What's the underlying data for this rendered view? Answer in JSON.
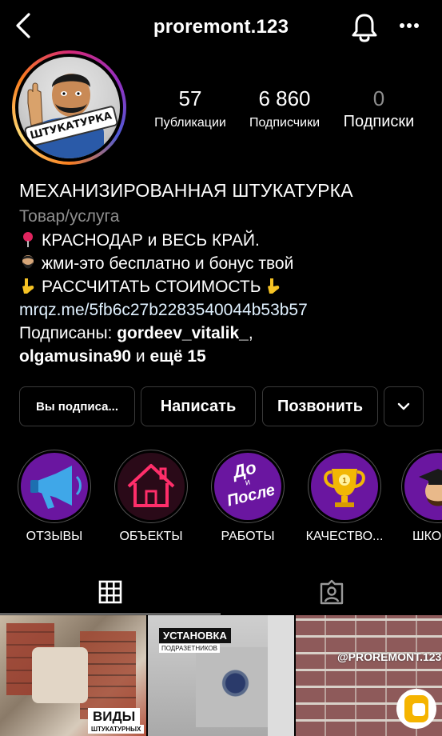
{
  "header": {
    "username": "proremont.123",
    "back_icon": "chevron-left-icon",
    "bell_icon": "bell-icon",
    "more_icon": "more-horizontal-icon"
  },
  "avatar": {
    "badge_text": "ШТУКАТУРКА"
  },
  "stats": {
    "posts": {
      "value": "57",
      "label": "Публикации"
    },
    "followers": {
      "value": "6 860",
      "label": "Подписчики"
    },
    "following": {
      "value": "0",
      "label": "Подписки"
    }
  },
  "bio": {
    "name": "МЕХАНИЗИРОВАННАЯ ШТУКАТУРКА",
    "category": "Товар/услуга",
    "line1": "КРАСНОДАР и ВЕСЬ КРАЙ.",
    "line2": "жми-это бесплатно и бонус твой",
    "line3": "РАССЧИТАТЬ СТОИМОСТЬ",
    "link": "mrqz.me/5fb6c27b2283540044b53b57",
    "followed_prefix": "Подписаны: ",
    "followed_user1": "gordeev_vitalik_",
    "followed_sep": ",",
    "followed_user2": "olgamusina90",
    "followed_and": " и ",
    "followed_more": "ещё 15"
  },
  "actions": {
    "following_label": "Вы подписа...",
    "message_label": "Написать",
    "call_label": "Позвонить",
    "expand_icon": "chevron-down-icon"
  },
  "highlights": [
    {
      "label": "ОТЗЫВЫ",
      "icon": "megaphone-icon"
    },
    {
      "label": "ОБЪЕКТЫ",
      "icon": "house-icon"
    },
    {
      "label": "РАБОТЫ",
      "icon": "before-after-icon",
      "text_top": "До",
      "text_mid": "и",
      "text_bottom": "После"
    },
    {
      "label": "КАЧЕСТВО...",
      "icon": "trophy-icon"
    },
    {
      "label": "ШКО",
      "icon": "graduate-icon"
    }
  ],
  "tabs": {
    "grid_icon": "grid-icon",
    "tagged_icon": "tagged-person-icon"
  },
  "posts": [
    {
      "caption": "ВИДЫ",
      "subcaption": "ШТУКАТУРНЫХ"
    },
    {
      "caption": "УСТАНОВКА",
      "subcaption": "ПОДРАЗЕТНИКОВ"
    },
    {
      "caption": "@PROREMONT.123"
    }
  ],
  "colors": {
    "background": "#000000",
    "highlight_purple": "#6a16a0",
    "link": "#e0f1ff",
    "muted": "#8e8e8e"
  }
}
